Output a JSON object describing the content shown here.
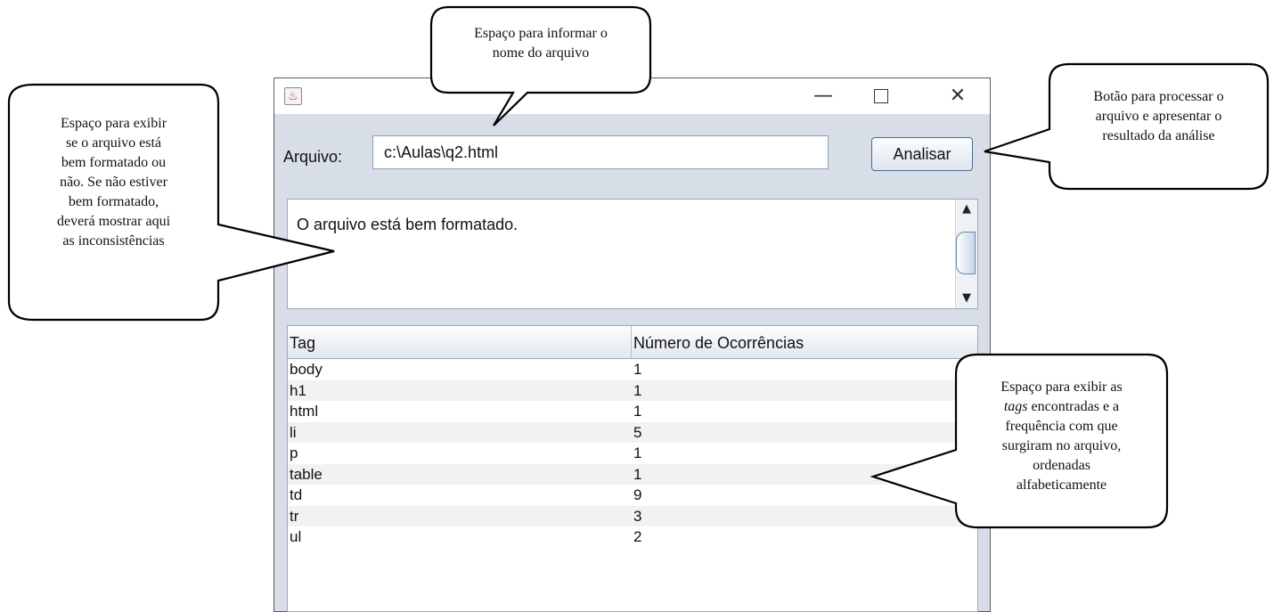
{
  "window": {
    "icon": "java-coffee-icon",
    "controls": {
      "minimize": "—",
      "maximize": "☐",
      "close": "✕"
    }
  },
  "form": {
    "label": "Arquivo:",
    "file_value": "c:\\Aulas\\q2.html",
    "button_label": "Analisar"
  },
  "status": {
    "message": "O arquivo está bem formatado."
  },
  "table": {
    "headers": [
      "Tag",
      "Número de Ocorrências"
    ],
    "rows": [
      {
        "tag": "body",
        "count": "1"
      },
      {
        "tag": "h1",
        "count": "1"
      },
      {
        "tag": "html",
        "count": "1"
      },
      {
        "tag": "li",
        "count": "5"
      },
      {
        "tag": "p",
        "count": "1"
      },
      {
        "tag": "table",
        "count": "1"
      },
      {
        "tag": "td",
        "count": "9"
      },
      {
        "tag": "tr",
        "count": "3"
      },
      {
        "tag": "ul",
        "count": "2"
      }
    ]
  },
  "callouts": {
    "filename": [
      "Espaço para informar o",
      "nome do arquivo"
    ],
    "button": [
      "Botão para processar o",
      "arquivo e apresentar o",
      "resultado da análise"
    ],
    "status": [
      "Espaço para exibir",
      "se o arquivo está",
      "bem formatado ou",
      "não. Se não estiver",
      "bem formatado,",
      "deverá mostrar aqui",
      "as inconsistências"
    ],
    "table": {
      "line1": "Espaço para exibir as",
      "line2_italic": "tags",
      "line2_rest": " encontradas e a",
      "lines_after": [
        "frequência com que",
        "surgiram no arquivo,",
        "ordenadas",
        "alfabeticamente"
      ]
    }
  }
}
